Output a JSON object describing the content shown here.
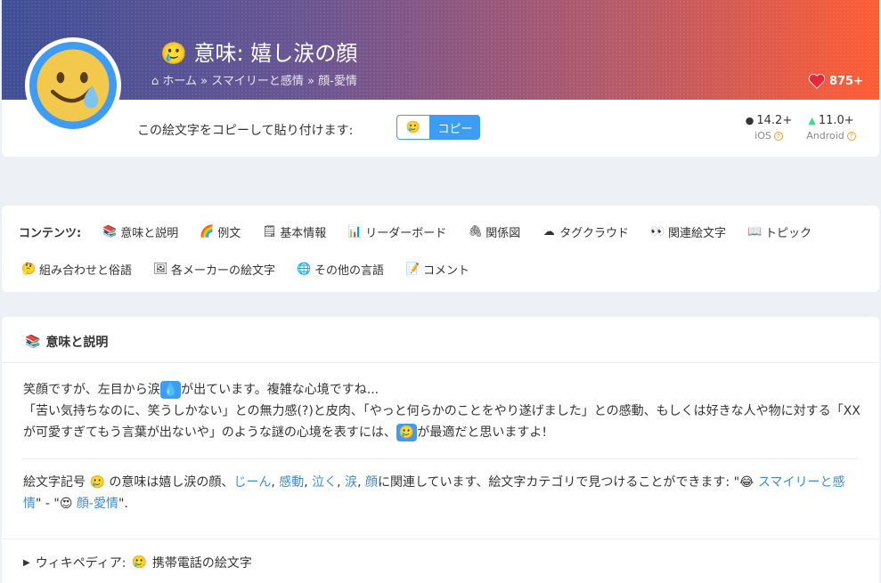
{
  "header": {
    "title_emoji": "🥲",
    "title": "意味: 嬉し涙の顔",
    "breadcrumb": [
      "ホーム",
      "スマイリーと感情",
      "顔-愛情"
    ],
    "breadcrumb_sep": "»",
    "likes": "875+",
    "copy_label": "この絵文字をコピーして貼り付けます:",
    "copy_emoji": "🥲",
    "copy_button": "コピー",
    "ios_version": "14.2+",
    "ios_label": "iOS",
    "android_version": "11.0+",
    "android_label": "Android"
  },
  "contents": {
    "title": "コンテンツ:",
    "items_row1": [
      {
        "icon": "📚",
        "label": "意味と説明"
      },
      {
        "icon": "🌈",
        "label": "例文"
      },
      {
        "icon": "🗒",
        "label": "基本情報"
      },
      {
        "icon": "📊",
        "label": "リーダーボード"
      },
      {
        "icon": "🖇",
        "label": "関係図"
      },
      {
        "icon": "☁",
        "label": "タグクラウド"
      },
      {
        "icon": "👀",
        "label": "関連絵文字"
      },
      {
        "icon": "📖",
        "label": "トピック"
      }
    ],
    "items_row2": [
      {
        "icon": "🤔",
        "label": "組み合わせと俗語"
      },
      {
        "icon": "🖼",
        "label": "各メーカーの絵文字"
      },
      {
        "icon": "🌐",
        "label": "その他の言語"
      },
      {
        "icon": "📝",
        "label": "コメント"
      }
    ]
  },
  "meaning": {
    "heading_icon": "📚",
    "heading": "意味と説明",
    "p1_a": "笑顔ですが、左目から涙",
    "p1_hl": "💧",
    "p1_b": "が出ています。複雑な心境ですね...",
    "p1_c": "「苦い気持ちなのに、笑うしかない」との無力感(?)と皮肉、「やっと何らかのことをやり遂げました」との感動、もしくは好きな人や物に対する「XXが可愛すぎてもう言葉が出ないや」のような謎の心境を表すには、",
    "p1_hl2": "🥲",
    "p1_d": "が最適だと思いますよ!",
    "p2_a": "絵文字記号 ",
    "p2_emoji": "🥲",
    "p2_b": " の意味は嬉し涙の顔、",
    "p2_links": [
      "じーん",
      "感動",
      "泣く",
      "涙",
      "顔"
    ],
    "p2_c": "に関連しています、絵文字カテゴリで見つけることができます: \"",
    "p2_cat1_icon": "😂",
    "p2_cat1": "スマイリーと感情",
    "p2_d": "\" - \"",
    "p2_cat2_icon": "😍",
    "p2_cat2": "顔-愛情",
    "p2_e": "\".",
    "wiki_label": "ウィキペディア:",
    "wiki_emoji": "🥲",
    "wiki_text": "携帯電話の絵文字"
  }
}
